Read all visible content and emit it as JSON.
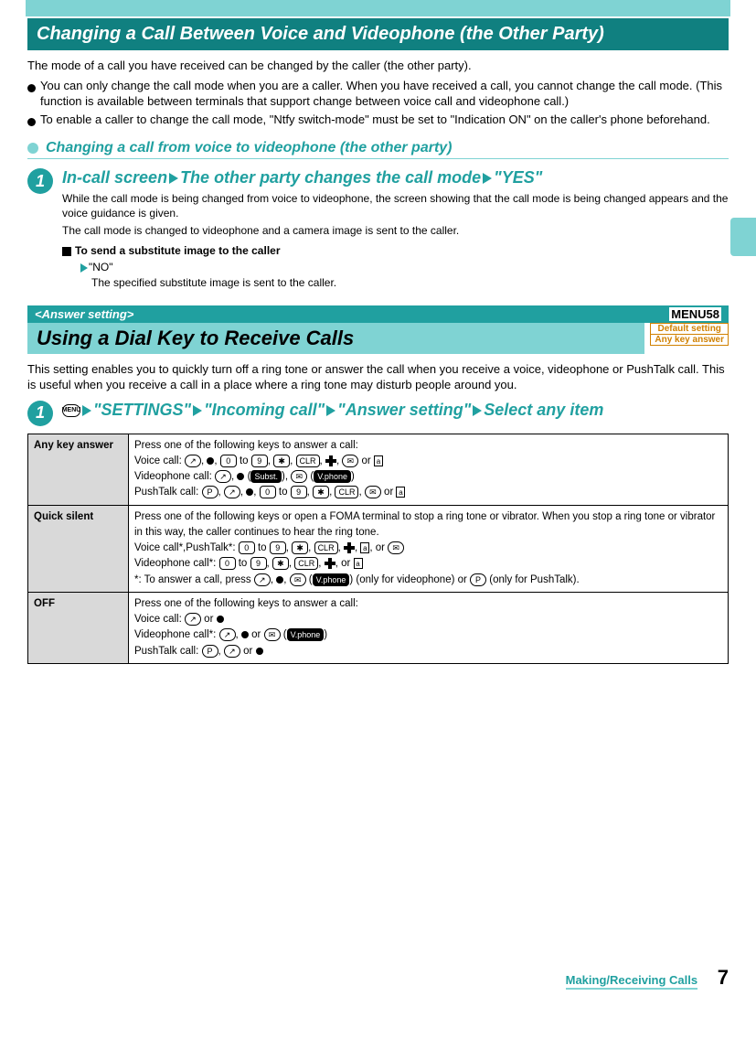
{
  "section1": {
    "title": "Changing a Call Between Voice and Videophone (the Other Party)",
    "intro": "The mode of a call you have received can be changed by the caller (the other party).",
    "bullet1": "You can only change the call mode when you are a caller. When you have received a call, you cannot change the call mode. (This function is available between terminals that support change between voice call and videophone call.)",
    "bullet2": "To enable a caller to change the call mode, \"Ntfy switch-mode\" must be set to \"Indication ON\" on the caller's phone beforehand.",
    "sub_title": "Changing a call from voice to videophone (the other party)",
    "step": {
      "num": "1",
      "h_a": "In-call screen",
      "h_b": "The other party changes the call mode",
      "h_c": "\"YES\"",
      "desc1": "While the call mode is being changed from voice to videophone, the screen showing that the call mode is being changed appears and the voice guidance is given.",
      "desc2": "The call mode is changed to videophone and a camera image is sent to the caller.",
      "sub_h": "To send a substitute image to the caller",
      "sub_opt": "\"NO\"",
      "sub_desc": "The specified substitute image is sent to the caller."
    }
  },
  "section2": {
    "tag": "<Answer setting>",
    "menu": "MENU58",
    "title": "Using a Dial Key to Receive Calls",
    "def1": "Default setting",
    "def2": "Any key answer",
    "desc": "This setting enables you to quickly turn off a ring tone or answer the call when you receive a voice, videophone or PushTalk call. This is useful when you receive a call in a place where a ring tone may disturb people around you.",
    "step": {
      "num": "1",
      "a": "\"SETTINGS\"",
      "b": "\"Incoming call\"",
      "c": "\"Answer setting\"",
      "d": "Select any item"
    },
    "table": [
      {
        "name": "Any key answer",
        "l1": "Press one of the following keys to answer a call:",
        "l2a": "Voice call:",
        "l3a": "Videophone call:",
        "l4a": "PushTalk call:"
      },
      {
        "name": "Quick silent",
        "l1": "Press one of the following keys or open a FOMA terminal to stop a ring tone or vibrator. When you stop a ring tone or vibrator in this way, the caller continues to hear the ring tone.",
        "l2a": "Voice call*,PushTalk*:",
        "l3a": "Videophone call*:",
        "l4a": "*: To answer a call, press",
        "l4b": "(only for videophone) or",
        "l4c": "(only for PushTalk)."
      },
      {
        "name": "OFF",
        "l1": "Press one of the following keys to answer a call:",
        "l2a": "Voice call:",
        "l3a": "Videophone call*:",
        "l4a": "PushTalk call:"
      }
    ]
  },
  "footer": {
    "section": "Making/Receiving Calls",
    "page": "7"
  }
}
